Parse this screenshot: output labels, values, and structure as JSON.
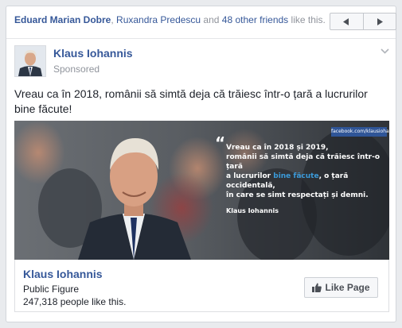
{
  "social_context": {
    "friend1": "Eduard Marian Dobre",
    "separator": ", ",
    "friend2": "Ruxandra Predescu",
    "and_text": " and ",
    "others": "48 other friends",
    "suffix": " like this."
  },
  "pager": {
    "prev_icon": "triangle-left-icon",
    "next_icon": "triangle-right-icon"
  },
  "post": {
    "page_name": "Klaus Iohannis",
    "sponsored_label": "Sponsored",
    "text": "Vreau ca în 2018, românii să simtă deja că trăiesc într-o țară a lucrurilor bine făcute!"
  },
  "image": {
    "watermark": "facebook.com/klausiohan",
    "quote_mark": "“",
    "quote_line1": "Vreau ca în 2018 și 2019,",
    "quote_line2": "românii să simtă deja că trăiesc într-o țară",
    "quote_line3_a": "a lucrurilor ",
    "quote_line3_b": "bine făcute",
    "quote_line3_c": ", o țară occidentală,",
    "quote_line4": "în care se simt respectați și demni.",
    "author": "Klaus Iohannis"
  },
  "footer": {
    "name": "Klaus Iohannis",
    "category": "Public Figure",
    "likes": "247,318 people like this.",
    "like_button": "Like Page"
  },
  "colors": {
    "link": "#365899",
    "background": "#e9ebee",
    "highlight": "#3b9ad9"
  }
}
